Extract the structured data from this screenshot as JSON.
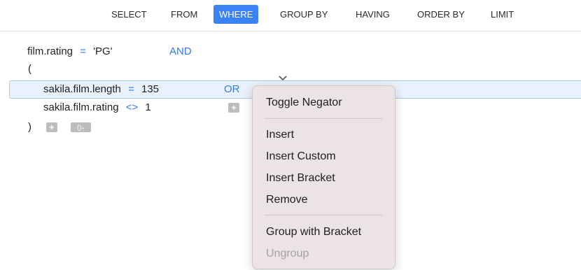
{
  "tabs": [
    {
      "label": "SELECT",
      "active": false
    },
    {
      "label": "FROM",
      "active": false
    },
    {
      "label": "WHERE",
      "active": true
    },
    {
      "label": "GROUP BY",
      "active": false
    },
    {
      "label": "HAVING",
      "active": false
    },
    {
      "label": "ORDER BY",
      "active": false
    },
    {
      "label": "LIMIT",
      "active": false
    }
  ],
  "conditions": {
    "c1": {
      "field": "film.rating",
      "op": "=",
      "value": "'PG'",
      "logic": "AND"
    },
    "open_bracket": "(",
    "c2": {
      "field": "sakila.film.length",
      "op": "=",
      "value": "135",
      "logic": "OR"
    },
    "c3": {
      "field": "sakila.film.rating",
      "op": "<>",
      "value": "1"
    },
    "close_bracket": ")",
    "add_label": "+",
    "add_bracket_label": "()₊"
  },
  "context_menu": {
    "toggle_negator": "Toggle Negator",
    "insert": "Insert",
    "insert_custom": "Insert Custom",
    "insert_bracket": "Insert Bracket",
    "remove": "Remove",
    "group_with_bracket": "Group with Bracket",
    "ungroup": "Ungroup"
  },
  "colors": {
    "accent": "#3b82f6",
    "operator": "#2f7cf0",
    "row_highlight": "#e8f1fc",
    "menu_bg": "#ece3e4"
  }
}
